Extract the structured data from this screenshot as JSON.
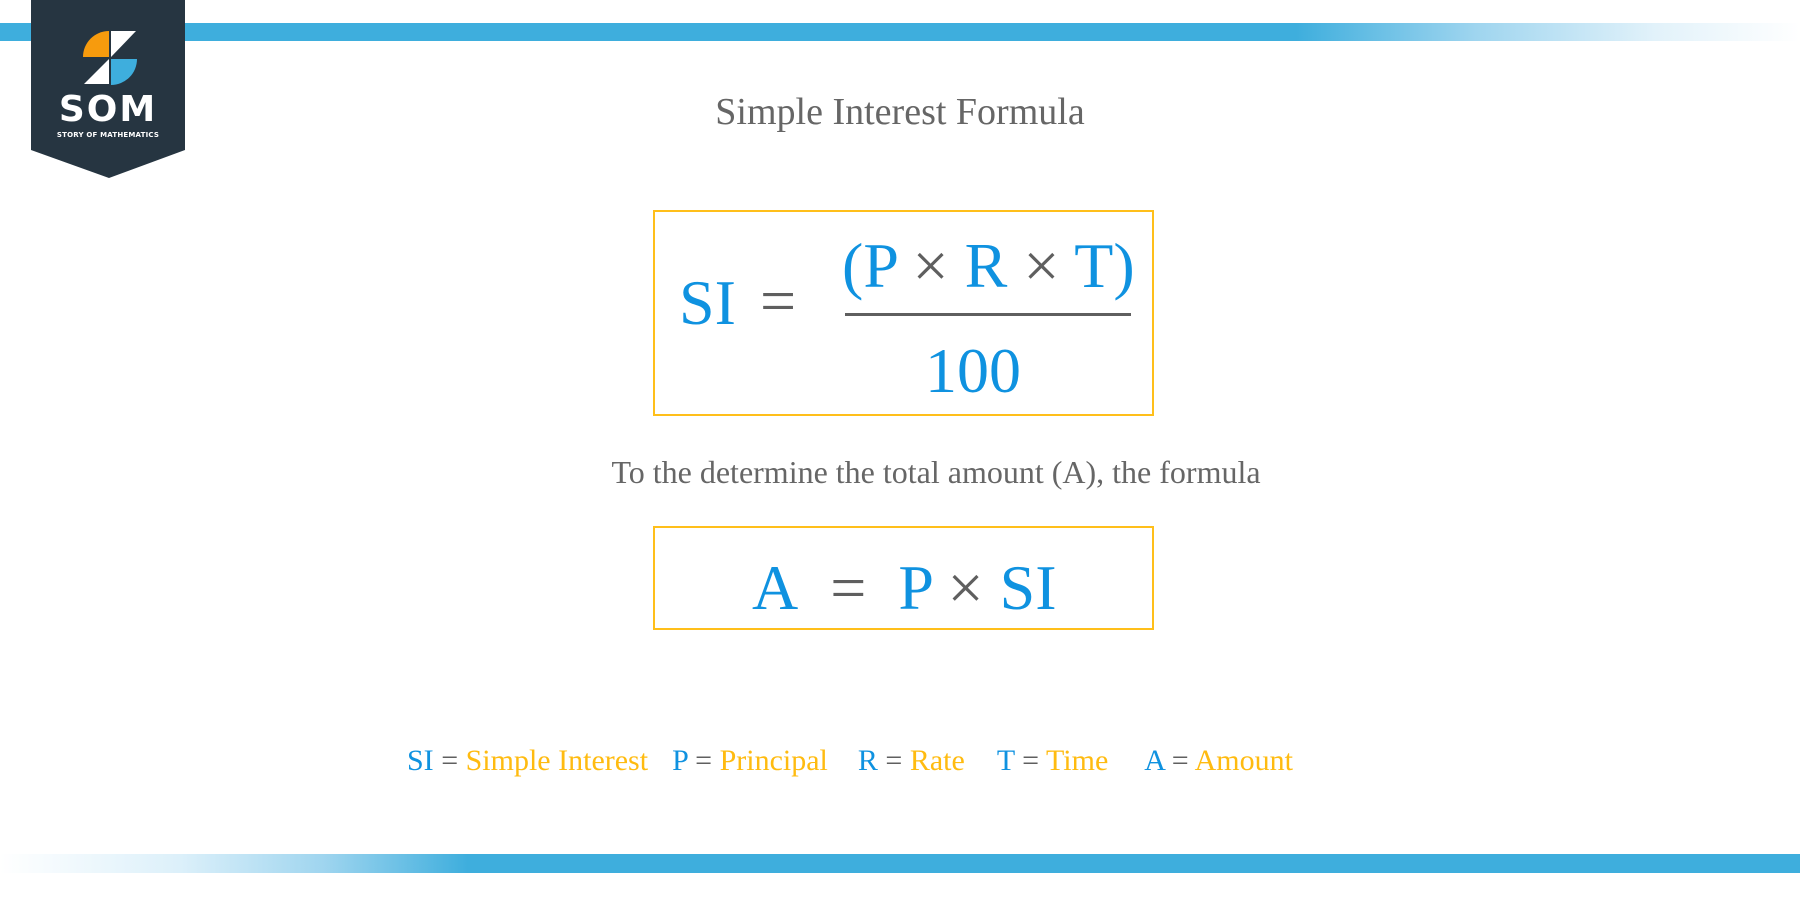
{
  "logo": {
    "name": "SOM",
    "subtitle": "STORY OF MATHEMATICS",
    "colors": {
      "background": "#263541",
      "orange": "#f79b0d",
      "blue": "#3eaedd",
      "white": "#ffffff"
    }
  },
  "title": "Simple Interest Formula",
  "formula1": {
    "lhs": "SI",
    "equals": "=",
    "numerator": {
      "open": "(",
      "p": "P",
      "times1": "×",
      "r": "R",
      "times2": "×",
      "t": "T",
      "close": ")"
    },
    "denominator": "100"
  },
  "subtitle": "To the determine the total amount (A), the formula",
  "formula2": {
    "lhs": "A",
    "equals": "=",
    "term1": "P",
    "times": "×",
    "term2": "SI"
  },
  "legend": [
    {
      "symbol": "SI",
      "equals": "=",
      "meaning": "Simple Interest"
    },
    {
      "symbol": "P",
      "equals": "=",
      "meaning": "Principal"
    },
    {
      "symbol": "R",
      "equals": "=",
      "meaning": "Rate"
    },
    {
      "symbol": "T",
      "equals": "=",
      "meaning": "Time"
    },
    {
      "symbol": "A",
      "equals": "=",
      "meaning": "Amount"
    }
  ],
  "colors": {
    "variable_blue": "#0f92e0",
    "operator_gray": "#5f5f5f",
    "meaning_gold": "#ffbb10",
    "box_border": "#ffbf1a",
    "bar_blue": "#3eaedd"
  }
}
